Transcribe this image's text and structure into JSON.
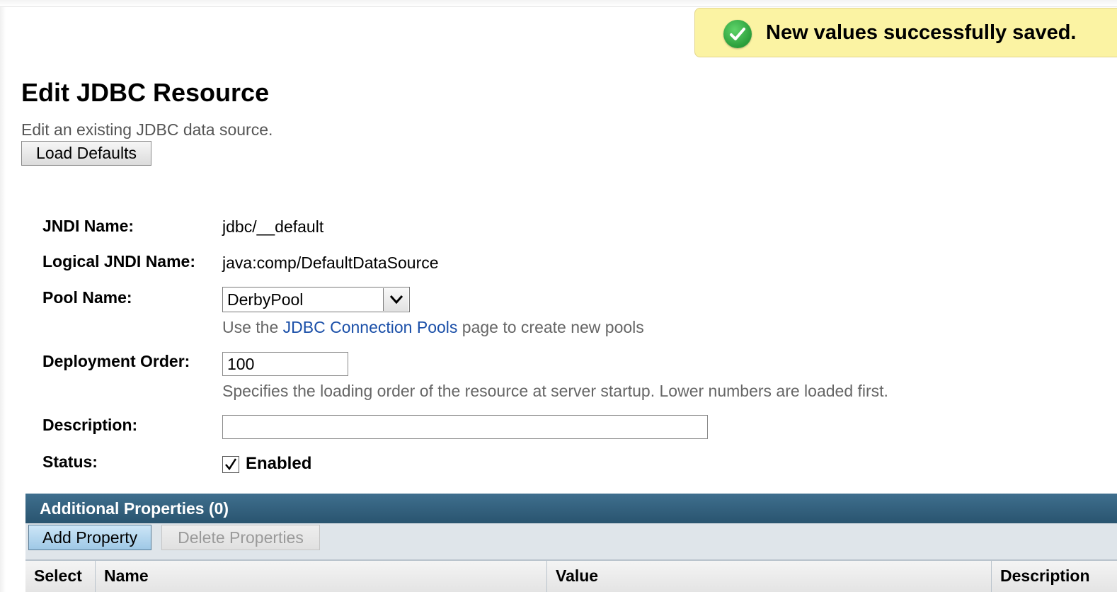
{
  "alert": {
    "message": "New values successfully saved.",
    "icon": "check-circle-icon",
    "color": "#fbf3a3"
  },
  "header": {
    "title": "Edit JDBC Resource",
    "subtitle": "Edit an existing JDBC data source."
  },
  "buttons": {
    "load_defaults": "Load Defaults"
  },
  "form": {
    "jndi_name": {
      "label": "JNDI Name:",
      "value": "jdbc/__default"
    },
    "logical_jndi_name": {
      "label": "Logical JNDI Name:",
      "value": "java:comp/DefaultDataSource"
    },
    "pool_name": {
      "label": "Pool Name:",
      "selected": "DerbyPool",
      "help_prefix": "Use the ",
      "help_link": "JDBC Connection Pools",
      "help_suffix": " page to create new pools"
    },
    "deployment_order": {
      "label": "Deployment Order:",
      "value": "100",
      "help": "Specifies the loading order of the resource at server startup. Lower numbers are loaded first."
    },
    "description": {
      "label": "Description:",
      "value": ""
    },
    "status": {
      "label": "Status:",
      "checkbox_label": "Enabled",
      "checked": true
    }
  },
  "properties_table": {
    "title": "Additional Properties (0)",
    "add_button": "Add Property",
    "delete_button": "Delete Properties",
    "columns": [
      "Select",
      "Name",
      "Value",
      "Description"
    ],
    "header_color": "#29546f"
  }
}
